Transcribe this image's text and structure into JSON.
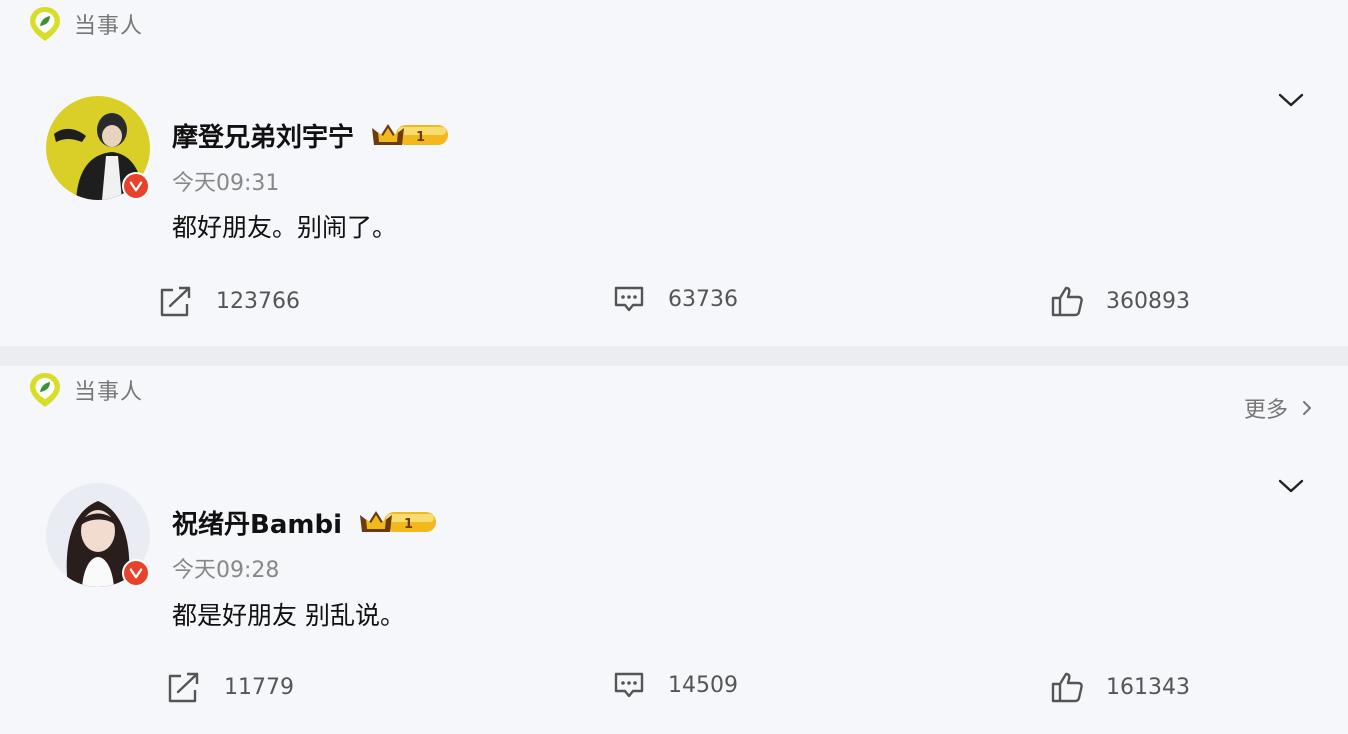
{
  "colors": {
    "card_bg": "#f6f7fb",
    "divider_bg": "#ecedf1",
    "tag_icon_yellow": "#d6de2a",
    "tag_icon_green": "#3f8f3a",
    "verified_red": "#e8412c",
    "crown_gold": "#f2b91c"
  },
  "posts": [
    {
      "tag_icon": "location-pin-icon",
      "tag_label": "当事人",
      "show_more": false,
      "username": "摩登兄弟刘宇宁",
      "badge_level": "1",
      "time": "今天09:31",
      "text": "都好朋友。别闹了。",
      "reposts": "123766",
      "comments": "63736",
      "likes": "360893"
    },
    {
      "tag_icon": "location-pin-icon",
      "tag_label": "当事人",
      "show_more": true,
      "more_label": "更多",
      "username": "祝绪丹Bambi",
      "badge_level": "1",
      "time": "今天09:28",
      "text": "都是好朋友 别乱说。",
      "reposts": "11779",
      "comments": "14509",
      "likes": "161343"
    }
  ]
}
